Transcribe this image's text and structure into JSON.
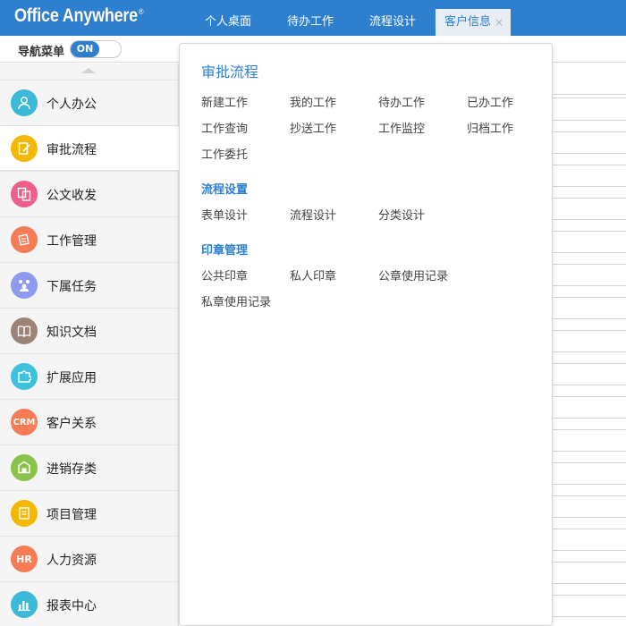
{
  "header": {
    "logo_text": "Office Anywhere",
    "logo_mark": "®",
    "tabs": [
      {
        "label": "个人桌面"
      },
      {
        "label": "待办工作"
      },
      {
        "label": "流程设计"
      },
      {
        "label": "客户信息",
        "close": "×"
      }
    ]
  },
  "subbar": {
    "nav_label": "导航菜单",
    "toggle_label": "ON"
  },
  "sidebar": {
    "items": [
      {
        "label": "个人办公",
        "icon": "person-icon",
        "color": "#3cb9d6"
      },
      {
        "label": "审批流程",
        "icon": "approval-icon",
        "color": "#f5b800"
      },
      {
        "label": "公文收发",
        "icon": "document-exchange-icon",
        "color": "#ee5f8a"
      },
      {
        "label": "工作管理",
        "icon": "work-icon",
        "color": "#f57c55"
      },
      {
        "label": "下属任务",
        "icon": "team-icon",
        "color": "#8c9bf0"
      },
      {
        "label": "知识文档",
        "icon": "book-icon",
        "color": "#9c8277"
      },
      {
        "label": "扩展应用",
        "icon": "puzzle-icon",
        "color": "#3cc2dd"
      },
      {
        "label": "客户关系",
        "icon": "crm-icon",
        "icon_text": "CRM",
        "color": "#f57c55"
      },
      {
        "label": "进销存类",
        "icon": "inventory-icon",
        "color": "#8bc34a"
      },
      {
        "label": "项目管理",
        "icon": "project-icon",
        "color": "#f5b800"
      },
      {
        "label": "人力资源",
        "icon": "hr-icon",
        "icon_text": "HR",
        "color": "#f57c55"
      },
      {
        "label": "报表中心",
        "icon": "report-icon",
        "color": "#3cb9d6"
      }
    ]
  },
  "panel": {
    "title": "审批流程",
    "group1": [
      "新建工作",
      "我的工作",
      "待办工作",
      "已办工作",
      "工作查询",
      "抄送工作",
      "工作监控",
      "归档工作",
      "工作委托"
    ],
    "section2_title": "流程设置",
    "group2": [
      "表单设计",
      "流程设计",
      "分类设计"
    ],
    "section3_title": "印章管理",
    "group3": [
      "公共印章",
      "私人印章",
      "公章使用记录",
      "私章使用记录"
    ]
  },
  "colors": {
    "accent": "#2f7fcf",
    "sidebar_bg": "#f5f5f5"
  }
}
